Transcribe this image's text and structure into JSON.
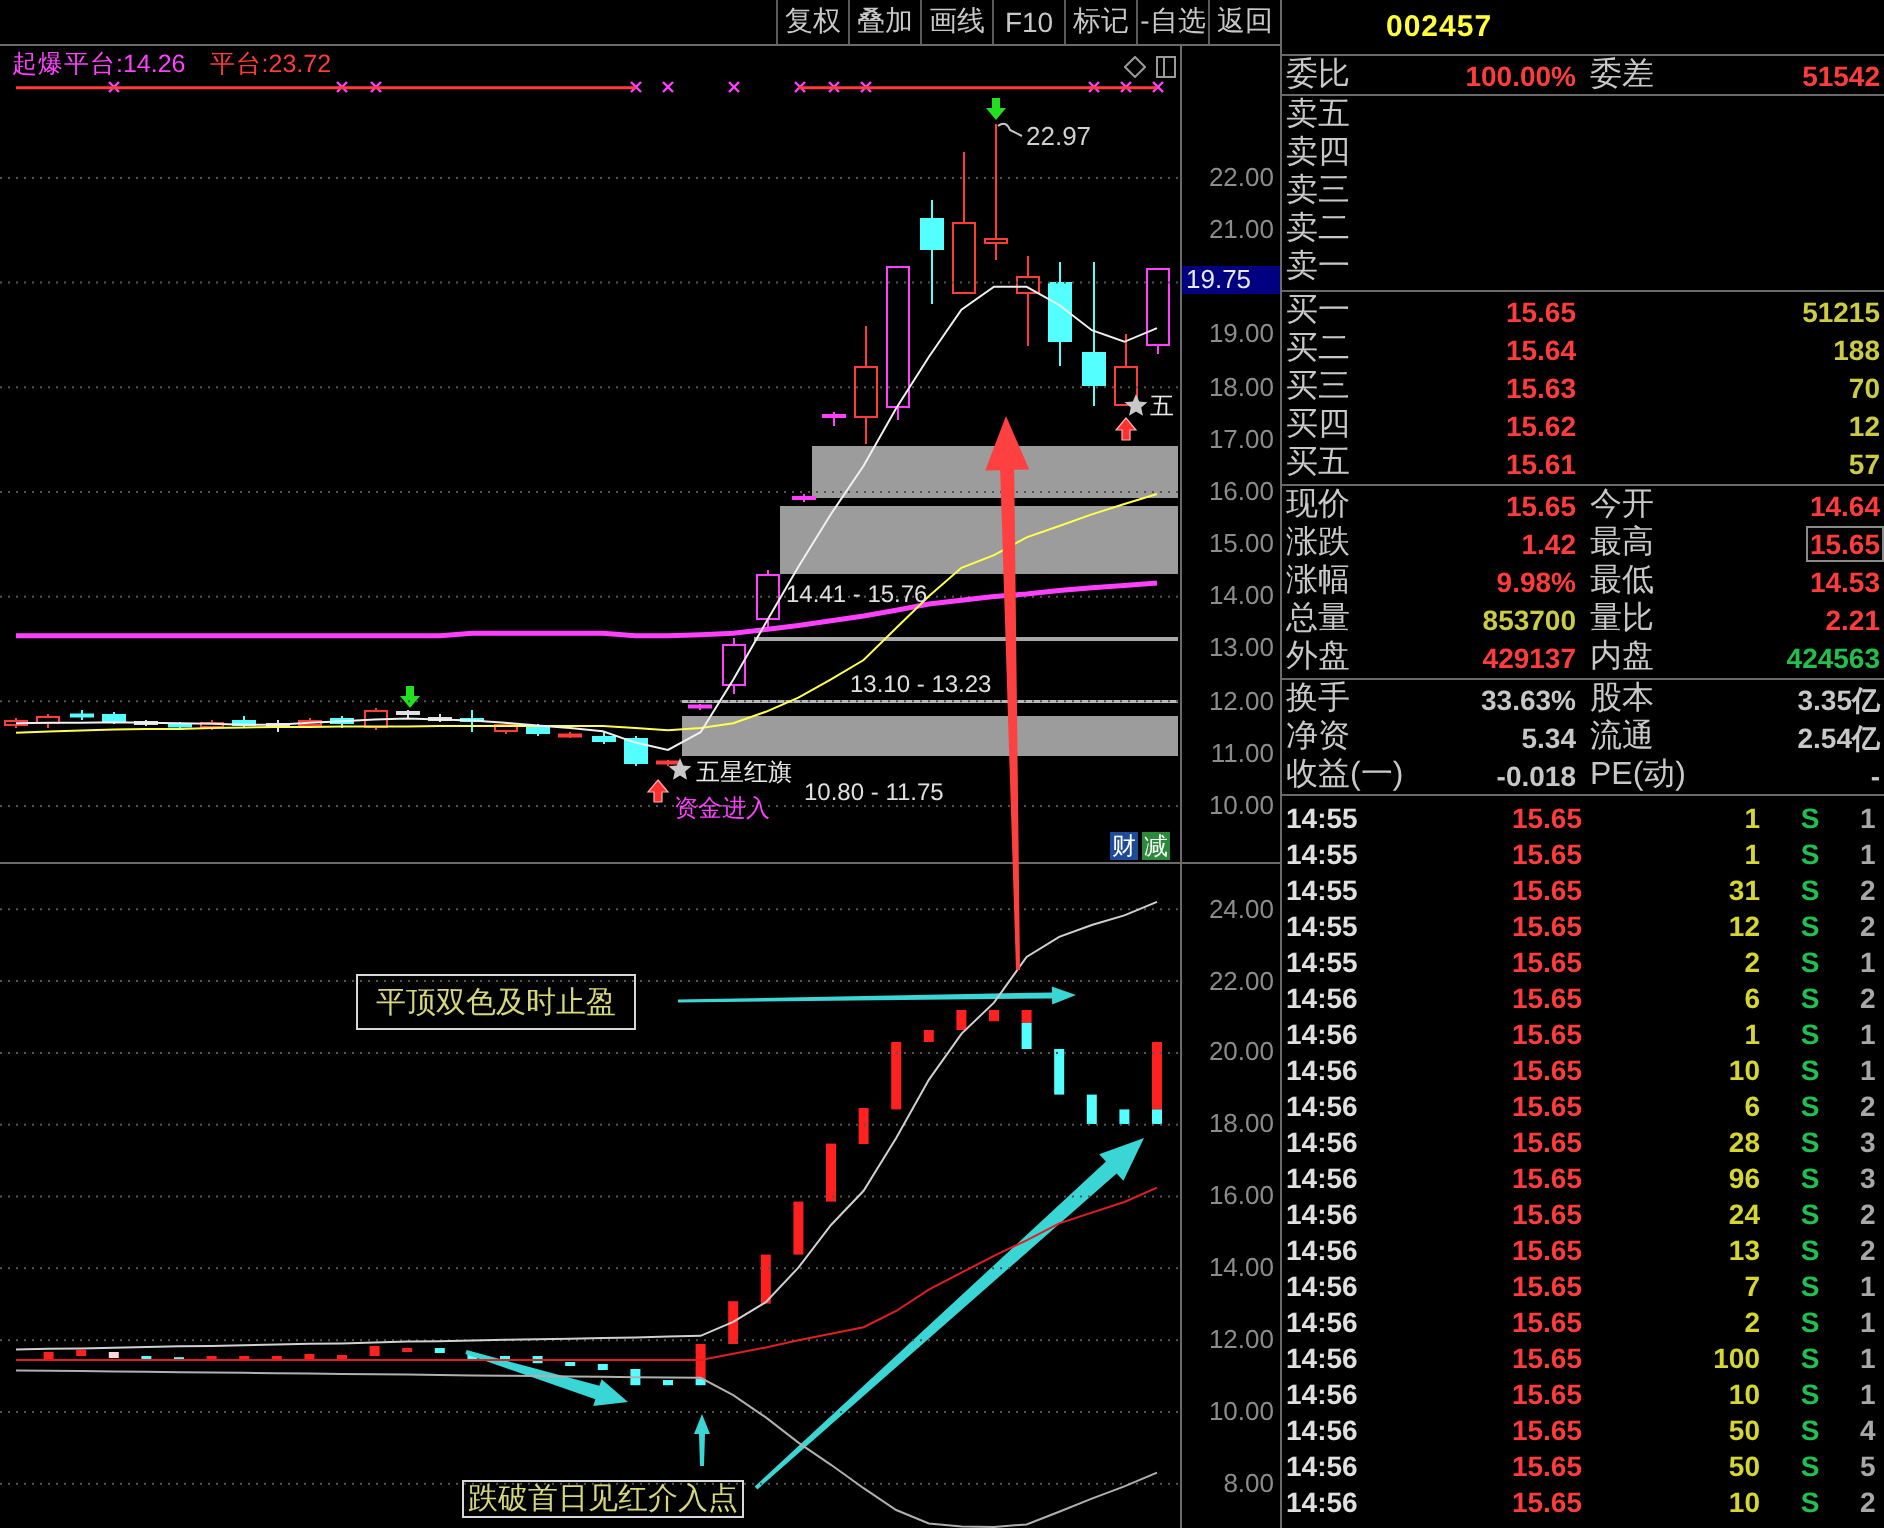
{
  "toolbar": {
    "buttons": [
      "复权",
      "叠加",
      "画线",
      "F10",
      "标记",
      "-自选",
      "返回"
    ]
  },
  "main_chart": {
    "legend": [
      {
        "label": "起爆平台:14.26",
        "color": "#ff40ff"
      },
      {
        "label": "平台:23.72",
        "color": "#ff3c3c"
      }
    ],
    "chart_data": {
      "type": "line",
      "grid": true,
      "ylim": [
        8.93,
        24.52
      ],
      "yticks": [
        {
          "value": 22,
          "label": "22.00"
        },
        {
          "value": 21,
          "label": "21.00"
        },
        {
          "value": 19,
          "label": "19.00"
        },
        {
          "value": 18,
          "label": "18.00"
        },
        {
          "value": 17,
          "label": "17.00"
        },
        {
          "value": 16,
          "label": "16.00"
        },
        {
          "value": 15,
          "label": "15.00"
        },
        {
          "value": 14,
          "label": "14.00"
        },
        {
          "value": 13,
          "label": "13.00"
        },
        {
          "value": 12,
          "label": "12.00"
        },
        {
          "value": 11,
          "label": "11.00"
        },
        {
          "value": 10,
          "label": "10.00"
        }
      ],
      "series": [
        {
          "color": "#ff3c3c",
          "values": [
            23.72,
            23.72,
            23.72,
            23.72,
            23.72,
            23.72,
            23.72,
            23.72,
            23.72,
            23.72,
            23.72,
            23.72,
            23.72,
            23.72,
            23.72,
            23.72,
            23.72,
            23.72,
            23.72,
            23.72,
            null,
            null,
            null,
            null,
            23.72,
            23.72,
            23.72,
            23.72,
            23.72,
            23.72,
            23.72,
            23.72,
            23.72,
            23.72,
            23.72,
            23.72
          ]
        },
        {
          "color": "#ff40ff",
          "values": [
            13.25,
            13.25,
            13.25,
            13.25,
            13.25,
            13.25,
            13.25,
            13.25,
            13.25,
            13.25,
            13.25,
            13.25,
            13.25,
            13.25,
            13.3,
            13.3,
            13.3,
            13.3,
            13.3,
            13.25,
            13.25,
            13.27,
            13.3,
            13.37,
            13.45,
            13.54,
            13.63,
            13.74,
            13.86,
            13.93,
            14.0,
            14.05,
            14.12,
            14.17,
            14.21,
            14.26
          ]
        },
        {
          "color": "#ffff50",
          "values": [
            11.4,
            11.42,
            11.44,
            11.46,
            11.47,
            11.47,
            11.49,
            11.5,
            11.51,
            11.51,
            11.52,
            11.52,
            11.52,
            11.53,
            11.53,
            11.53,
            11.53,
            11.53,
            11.53,
            11.49,
            11.45,
            11.49,
            11.58,
            11.8,
            12.07,
            12.42,
            12.79,
            13.4,
            14.01,
            14.55,
            14.79,
            15.13,
            15.35,
            15.57,
            15.77,
            15.96
          ]
        },
        {
          "color": "#f0f0f0",
          "values": [
            11.58,
            11.59,
            11.59,
            11.6,
            11.59,
            11.58,
            11.57,
            11.55,
            11.55,
            11.59,
            11.62,
            11.65,
            11.67,
            11.65,
            11.63,
            11.59,
            11.54,
            11.49,
            11.43,
            11.21,
            11.07,
            11.41,
            12.41,
            13.5,
            14.57,
            15.58,
            16.5,
            17.6,
            18.58,
            19.48,
            19.92,
            19.92,
            19.57,
            19.09,
            18.87,
            19.13
          ]
        }
      ]
    },
    "current_price": "19.75",
    "peak_label": "22.97",
    "zone_labels": [
      "14.41 - 15.76",
      "13.10 - 13.23",
      "10.80 - 11.75"
    ],
    "signal_labels": [
      "五星红旗",
      "五"
    ],
    "entry_label": "资金进入",
    "badges": [
      {
        "text": "财",
        "color": "#1e4a9a"
      },
      {
        "text": "减",
        "color": "#2a8a3a"
      }
    ]
  },
  "lower_chart": {
    "chart_data": {
      "type": "line",
      "grid": true,
      "ylim": [
        6.77,
        25.26
      ],
      "yticks": [
        {
          "value": 24,
          "label": "24.00"
        },
        {
          "value": 22,
          "label": "22.00"
        },
        {
          "value": 20,
          "label": "20.00"
        },
        {
          "value": 18,
          "label": "18.00"
        },
        {
          "value": 16,
          "label": "16.00"
        },
        {
          "value": 14,
          "label": "14.00"
        },
        {
          "value": 12,
          "label": "12.00"
        },
        {
          "value": 10,
          "label": "10.00"
        },
        {
          "value": 8,
          "label": "8.00"
        }
      ],
      "series": [
        {
          "color": "#d0d0d0",
          "values": [
            11.74,
            11.76,
            11.77,
            11.79,
            11.81,
            11.83,
            11.84,
            11.86,
            11.88,
            11.9,
            11.91,
            11.93,
            11.96,
            11.97,
            11.99,
            12.01,
            12.03,
            12.04,
            12.06,
            12.08,
            12.1,
            12.12,
            12.51,
            13.06,
            14.02,
            15.21,
            16.16,
            17.63,
            19.25,
            20.53,
            21.4,
            22.67,
            23.23,
            23.56,
            23.83,
            24.21
          ]
        },
        {
          "color": "#e02020",
          "values": [
            11.45,
            11.45,
            11.45,
            11.45,
            11.45,
            11.45,
            11.45,
            11.45,
            11.45,
            11.45,
            11.45,
            11.45,
            11.45,
            11.45,
            11.45,
            11.45,
            11.45,
            11.45,
            11.45,
            11.45,
            11.45,
            11.45,
            11.62,
            11.8,
            12.0,
            12.18,
            12.36,
            12.81,
            13.41,
            13.88,
            14.35,
            14.78,
            15.25,
            15.55,
            15.85,
            16.25
          ]
        },
        {
          "color": "#b0b0b0",
          "values": [
            11.16,
            11.15,
            11.14,
            11.13,
            11.12,
            11.11,
            11.1,
            11.09,
            11.08,
            11.07,
            11.06,
            11.05,
            11.04,
            11.03,
            11.02,
            11.01,
            11.0,
            10.99,
            10.98,
            10.97,
            10.96,
            10.95,
            10.47,
            9.85,
            9.15,
            8.53,
            7.88,
            7.27,
            6.9,
            6.81,
            6.8,
            6.87,
            7.22,
            7.59,
            7.93,
            8.31
          ]
        }
      ]
    },
    "callouts": [
      "平顶双色及时止盈",
      "跌破首日见红介入点"
    ]
  },
  "quote": {
    "code": "002457",
    "ratio": [
      {
        "label": "委比",
        "value": "100.00%"
      },
      {
        "label": "委差",
        "value": "51542"
      }
    ],
    "asks": [
      "卖五",
      "卖四",
      "卖三",
      "卖二",
      "卖一"
    ],
    "bids": [
      {
        "label": "买一",
        "price": "15.65",
        "volume": "51215"
      },
      {
        "label": "买二",
        "price": "15.64",
        "volume": "188"
      },
      {
        "label": "买三",
        "price": "15.63",
        "volume": "70"
      },
      {
        "label": "买四",
        "price": "15.62",
        "volume": "12"
      },
      {
        "label": "买五",
        "price": "15.61",
        "volume": "57"
      }
    ],
    "stats": [
      {
        "label": "现价",
        "value": "15.65",
        "color": "#ff3c3c",
        "highlighted": false
      },
      {
        "label": "今开",
        "value": "14.64",
        "color": "#ff3c3c",
        "highlighted": false
      },
      {
        "label": "涨跌",
        "value": "1.42",
        "color": "#ff3c3c",
        "highlighted": false
      },
      {
        "label": "最高",
        "value": "15.65",
        "color": "#ff3c3c",
        "highlighted": true
      },
      {
        "label": "涨幅",
        "value": "9.98%",
        "color": "#ff3c3c",
        "highlighted": false
      },
      {
        "label": "最低",
        "value": "14.53",
        "color": "#ff3c3c",
        "highlighted": false
      },
      {
        "label": "总量",
        "value": "853700",
        "color": "#cccc44",
        "highlighted": false
      },
      {
        "label": "量比",
        "value": "2.21",
        "color": "#ff3c3c",
        "highlighted": false
      },
      {
        "label": "外盘",
        "value": "429137",
        "color": "#ff3c3c",
        "highlighted": false
      },
      {
        "label": "内盘",
        "value": "424563",
        "color": "#22c04a",
        "highlighted": false
      }
    ],
    "fundamentals": [
      {
        "label": "换手",
        "value": "33.63%"
      },
      {
        "label": "股本",
        "value": "3.35亿"
      },
      {
        "label": "净资",
        "value": "5.34"
      },
      {
        "label": "流通",
        "value": "2.54亿"
      },
      {
        "label": "收益(一)",
        "value": "-0.018"
      },
      {
        "label": "PE(动)",
        "value": "-"
      }
    ]
  },
  "trades": [
    {
      "time": "14:55",
      "price": "15.65",
      "volume": "1",
      "side": "S",
      "column_5": "1"
    },
    {
      "time": "14:55",
      "price": "15.65",
      "volume": "1",
      "side": "S",
      "column_5": "1"
    },
    {
      "time": "14:55",
      "price": "15.65",
      "volume": "31",
      "side": "S",
      "column_5": "2"
    },
    {
      "time": "14:55",
      "price": "15.65",
      "volume": "12",
      "side": "S",
      "column_5": "2"
    },
    {
      "time": "14:55",
      "price": "15.65",
      "volume": "2",
      "side": "S",
      "column_5": "1"
    },
    {
      "time": "14:56",
      "price": "15.65",
      "volume": "6",
      "side": "S",
      "column_5": "2"
    },
    {
      "time": "14:56",
      "price": "15.65",
      "volume": "1",
      "side": "S",
      "column_5": "1"
    },
    {
      "time": "14:56",
      "price": "15.65",
      "volume": "10",
      "side": "S",
      "column_5": "1"
    },
    {
      "time": "14:56",
      "price": "15.65",
      "volume": "6",
      "side": "S",
      "column_5": "2"
    },
    {
      "time": "14:56",
      "price": "15.65",
      "volume": "28",
      "side": "S",
      "column_5": "3"
    },
    {
      "time": "14:56",
      "price": "15.65",
      "volume": "96",
      "side": "S",
      "column_5": "3"
    },
    {
      "time": "14:56",
      "price": "15.65",
      "volume": "24",
      "side": "S",
      "column_5": "2"
    },
    {
      "time": "14:56",
      "price": "15.65",
      "volume": "13",
      "side": "S",
      "column_5": "2"
    },
    {
      "time": "14:56",
      "price": "15.65",
      "volume": "7",
      "side": "S",
      "column_5": "1"
    },
    {
      "time": "14:56",
      "price": "15.65",
      "volume": "2",
      "side": "S",
      "column_5": "1"
    },
    {
      "time": "14:56",
      "price": "15.65",
      "volume": "100",
      "side": "S",
      "column_5": "1"
    },
    {
      "time": "14:56",
      "price": "15.65",
      "volume": "10",
      "side": "S",
      "column_5": "1"
    },
    {
      "time": "14:56",
      "price": "15.65",
      "volume": "50",
      "side": "S",
      "column_5": "4"
    },
    {
      "time": "14:56",
      "price": "15.65",
      "volume": "50",
      "side": "S",
      "column_5": "5"
    },
    {
      "time": "14:56",
      "price": "15.65",
      "volume": "10",
      "side": "S",
      "column_5": "2"
    }
  ]
}
